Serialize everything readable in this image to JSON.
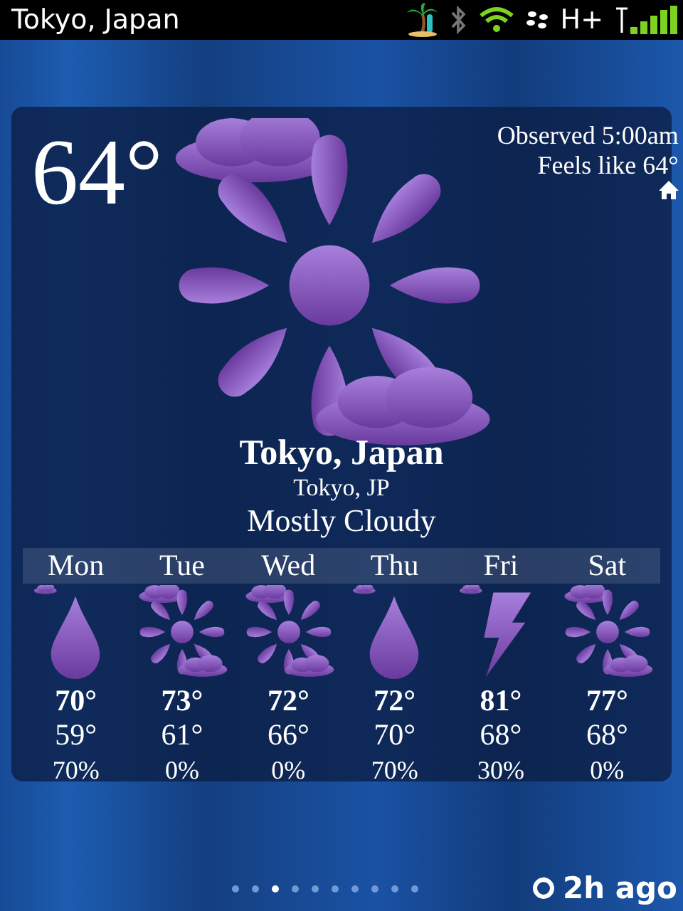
{
  "status_bar": {
    "title": "Tokyo, Japan",
    "network": "H+"
  },
  "current": {
    "temperature": "64°",
    "observed": "Observed 5:00am",
    "feels_like": "Feels like 64°",
    "kind": "partly-cloudy",
    "location": "Tokyo, Japan",
    "sublocation": "Tokyo, JP",
    "condition": "Mostly Cloudy"
  },
  "forecast": [
    {
      "day": "Mon",
      "kind": "rain",
      "high": "70°",
      "low": "59°",
      "precip": "70%"
    },
    {
      "day": "Tue",
      "kind": "partly-cloudy",
      "high": "73°",
      "low": "61°",
      "precip": "0%"
    },
    {
      "day": "Wed",
      "kind": "partly-cloudy",
      "high": "72°",
      "low": "66°",
      "precip": "0%"
    },
    {
      "day": "Thu",
      "kind": "rain",
      "high": "72°",
      "low": "70°",
      "precip": "70%"
    },
    {
      "day": "Fri",
      "kind": "thunder",
      "high": "81°",
      "low": "68°",
      "precip": "30%"
    },
    {
      "day": "Sat",
      "kind": "partly-cloudy",
      "high": "77°",
      "low": "68°",
      "precip": "0%"
    }
  ],
  "pages": [
    {
      "selected": false
    },
    {
      "selected": false
    },
    {
      "selected": true
    },
    {
      "selected": false
    },
    {
      "selected": false
    },
    {
      "selected": false
    },
    {
      "selected": false
    },
    {
      "selected": false
    },
    {
      "selected": false
    },
    {
      "selected": false
    }
  ],
  "updated": "2h ago"
}
